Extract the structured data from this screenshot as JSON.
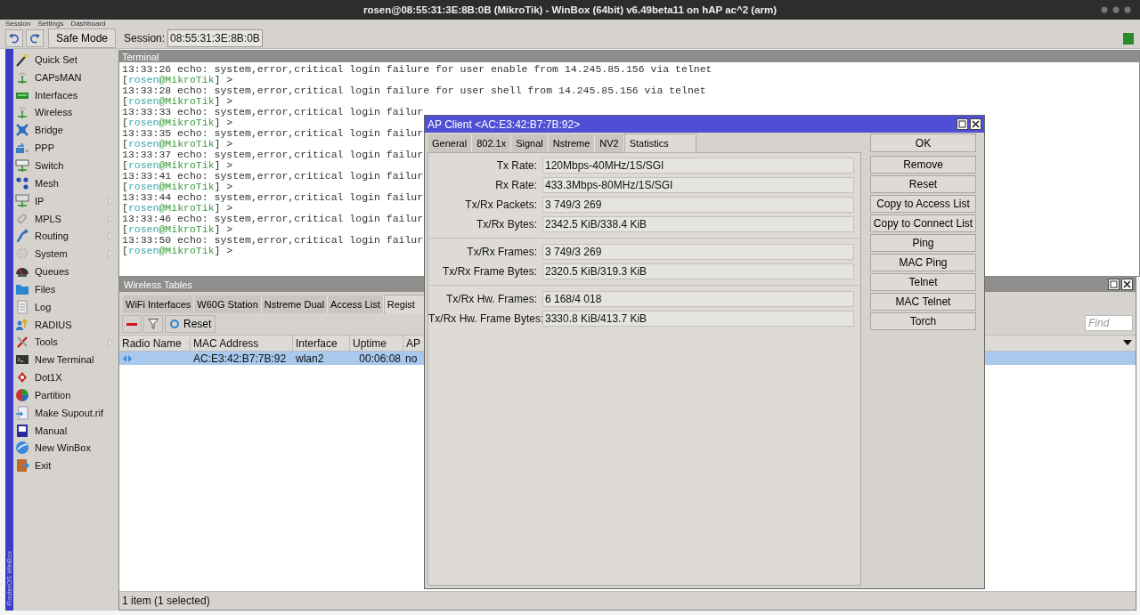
{
  "window": {
    "title": "rosen@08:55:31:3E:8B:0B (MikroTik) - WinBox (64bit) v6.49beta11 on hAP ac^2 (arm)"
  },
  "menu_bar": [
    "Session",
    "Settings",
    "Dashboard"
  ],
  "toolbar": {
    "safe_mode": "Safe Mode",
    "session_label": "Session:",
    "session_value": "08:55:31:3E:8B:0B"
  },
  "sidebar": {
    "brand": "RouterOS WinBox",
    "items": [
      {
        "label": "Quick Set",
        "submenu": false
      },
      {
        "label": "CAPsMAN",
        "submenu": false
      },
      {
        "label": "Interfaces",
        "submenu": false
      },
      {
        "label": "Wireless",
        "submenu": false
      },
      {
        "label": "Bridge",
        "submenu": false
      },
      {
        "label": "PPP",
        "submenu": false
      },
      {
        "label": "Switch",
        "submenu": false
      },
      {
        "label": "Mesh",
        "submenu": false
      },
      {
        "label": "IP",
        "submenu": true
      },
      {
        "label": "MPLS",
        "submenu": true
      },
      {
        "label": "Routing",
        "submenu": true
      },
      {
        "label": "System",
        "submenu": true
      },
      {
        "label": "Queues",
        "submenu": false
      },
      {
        "label": "Files",
        "submenu": false
      },
      {
        "label": "Log",
        "submenu": false
      },
      {
        "label": "RADIUS",
        "submenu": false
      },
      {
        "label": "Tools",
        "submenu": true
      },
      {
        "label": "New Terminal",
        "submenu": false
      },
      {
        "label": "Dot1X",
        "submenu": false
      },
      {
        "label": "Partition",
        "submenu": false
      },
      {
        "label": "Make Supout.rif",
        "submenu": false
      },
      {
        "label": "Manual",
        "submenu": false
      },
      {
        "label": "New WinBox",
        "submenu": false
      },
      {
        "label": "Exit",
        "submenu": false
      }
    ]
  },
  "terminal": {
    "title": "Terminal",
    "lines": [
      {
        "kind": "log",
        "text": "13:33:26 echo: system,error,critical login failure for user enable from 14.245.85.156 via telnet"
      },
      {
        "kind": "prompt",
        "parts": [
          "[",
          "rosen",
          "@MikroTik",
          "] >"
        ]
      },
      {
        "kind": "log",
        "text": "13:33:28 echo: system,error,critical login failure for user shell from 14.245.85.156 via telnet"
      },
      {
        "kind": "prompt",
        "parts": [
          "[",
          "rosen",
          "@MikroTik",
          "] >"
        ]
      },
      {
        "kind": "log",
        "text": "13:33:33 echo: system,error,critical login failur"
      },
      {
        "kind": "prompt",
        "parts": [
          "[",
          "rosen",
          "@MikroTik",
          "] >"
        ]
      },
      {
        "kind": "log",
        "text": "13:33:35 echo: system,error,critical login failur"
      },
      {
        "kind": "prompt",
        "parts": [
          "[",
          "rosen",
          "@MikroTik",
          "] >"
        ]
      },
      {
        "kind": "log",
        "text": "13:33:37 echo: system,error,critical login failur"
      },
      {
        "kind": "prompt",
        "parts": [
          "[",
          "rosen",
          "@MikroTik",
          "] >"
        ]
      },
      {
        "kind": "log",
        "text": "13:33:41 echo: system,error,critical login failur"
      },
      {
        "kind": "prompt",
        "parts": [
          "[",
          "rosen",
          "@MikroTik",
          "] >"
        ]
      },
      {
        "kind": "log",
        "text": "13:33:44 echo: system,error,critical login failur"
      },
      {
        "kind": "prompt",
        "parts": [
          "[",
          "rosen",
          "@MikroTik",
          "] >"
        ]
      },
      {
        "kind": "log",
        "text": "13:33:46 echo: system,error,critical login failur"
      },
      {
        "kind": "prompt",
        "parts": [
          "[",
          "rosen",
          "@MikroTik",
          "] >"
        ]
      },
      {
        "kind": "log",
        "text": "13:33:50 echo: system,error,critical login failur"
      },
      {
        "kind": "prompt",
        "parts": [
          "[",
          "rosen",
          "@MikroTik",
          "] >"
        ]
      }
    ]
  },
  "wireless_tables": {
    "title": "Wireless Tables",
    "tabs": [
      {
        "label": "WiFi Interfaces",
        "selected": false
      },
      {
        "label": "W60G Station",
        "selected": false
      },
      {
        "label": "Nstreme Dual",
        "selected": false
      },
      {
        "label": "Access List",
        "selected": false
      },
      {
        "label": "Regist",
        "selected": true
      }
    ],
    "reset": "Reset",
    "find": {
      "placeholder": "Find"
    },
    "columns": [
      {
        "label": "Radio Name",
        "sorted": true
      },
      {
        "label": "MAC Address",
        "sorted": false
      },
      {
        "label": "Interface",
        "sorted": false
      },
      {
        "label": "Uptime",
        "sorted": false
      },
      {
        "label": "AP",
        "sorted": false
      }
    ],
    "rows": [
      {
        "selected": true,
        "mac": "AC:E3:42:B7:7B:92",
        "interface": "wlan2",
        "uptime": "00:06:08",
        "ap": "no"
      }
    ],
    "status": "1 item (1 selected)"
  },
  "dialog": {
    "title": "AP Client <AC:E3:42:B7:7B:92>",
    "tabs": [
      {
        "label": "General",
        "selected": false
      },
      {
        "label": "802.1x",
        "selected": false
      },
      {
        "label": "Signal",
        "selected": false
      },
      {
        "label": "Nstreme",
        "selected": false
      },
      {
        "label": "NV2",
        "selected": false
      },
      {
        "label": "Statistics",
        "selected": true
      }
    ],
    "field_groups": [
      {
        "fields": [
          {
            "label": "Tx Rate:",
            "value": "120Mbps-40MHz/1S/SGI"
          },
          {
            "label": "Rx Rate:",
            "value": "433.3Mbps-80MHz/1S/SGI"
          },
          {
            "label": "Tx/Rx Packets:",
            "value": "3 749/3 269"
          },
          {
            "label": "Tx/Rx Bytes:",
            "value": "2342.5 KiB/338.4 KiB"
          }
        ]
      },
      {
        "fields": [
          {
            "label": "Tx/Rx Frames:",
            "value": "3 749/3 269"
          },
          {
            "label": "Tx/Rx Frame Bytes:",
            "value": "2320.5 KiB/319.3 KiB"
          }
        ]
      },
      {
        "fields": [
          {
            "label": "Tx/Rx Hw. Frames:",
            "value": "6 168/4 018"
          },
          {
            "label": "Tx/Rx Hw. Frame Bytes:",
            "value": "3330.8 KiB/413.7 KiB"
          }
        ]
      }
    ],
    "buttons": [
      "OK",
      "Remove",
      "Reset",
      "Copy to Access List",
      "Copy to Connect List",
      "Ping",
      "MAC Ping",
      "Telnet",
      "MAC Telnet",
      "Torch"
    ]
  }
}
